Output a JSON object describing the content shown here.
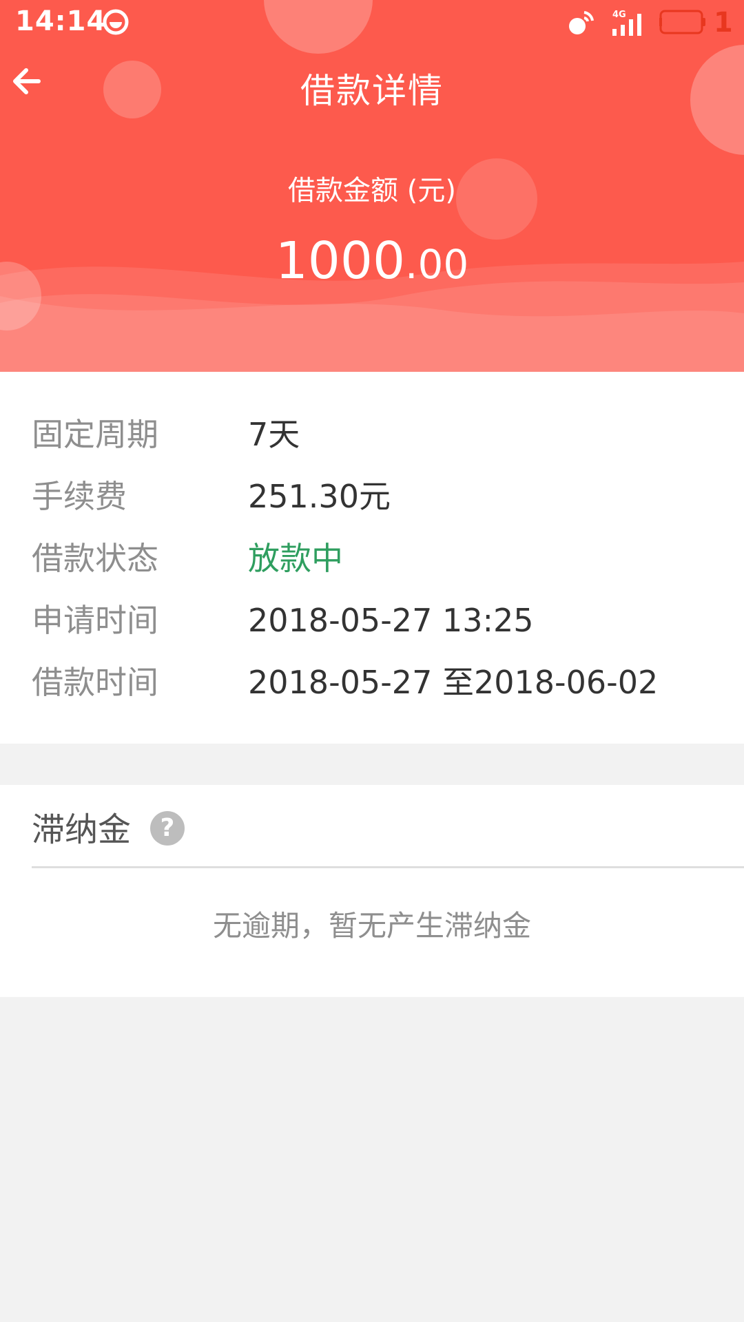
{
  "status_bar": {
    "time": "14:14",
    "network_type": "4G",
    "battery_level": "1",
    "icons": [
      "smile-icon",
      "signal-wifi-icon",
      "cell-signal-icon",
      "battery-icon"
    ]
  },
  "header": {
    "title": "借款详情",
    "back_icon": "arrow-left-icon",
    "amount_label": "借款金额 (元)",
    "amount_integer": "1000",
    "amount_decimal": ".00",
    "bg_color": "#fd5a4d"
  },
  "details": {
    "rows": [
      {
        "label": "固定周期",
        "value": "7天"
      },
      {
        "label": "手续费",
        "value": "251.30元"
      },
      {
        "label": "借款状态",
        "value": "放款中"
      },
      {
        "label": "申请时间",
        "value": "2018-05-27 13:25"
      },
      {
        "label": "借款时间",
        "value": "2018-05-27 至2018-06-02"
      }
    ],
    "status_color": "#2f9e5f"
  },
  "late_fee": {
    "title": "滞纳金",
    "help_icon": "question-mark-icon",
    "help_glyph": "?",
    "empty_text": "无逾期，暂无产生滞纳金"
  }
}
